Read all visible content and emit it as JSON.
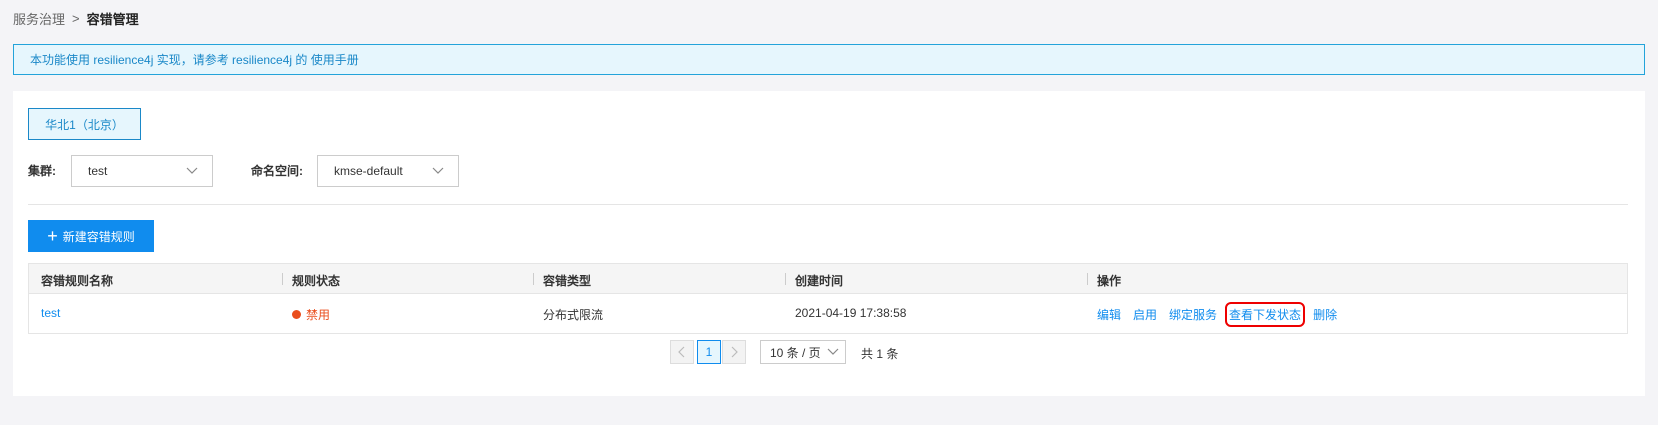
{
  "breadcrumb": {
    "parent": "服务治理",
    "separator": ">",
    "current": "容错管理"
  },
  "notice": {
    "text": "本功能使用 resilience4j 实现，请参考 resilience4j 的 使用手册"
  },
  "region": {
    "label": "华北1（北京）"
  },
  "filters": {
    "cluster_label": "集群:",
    "cluster_value": "test",
    "namespace_label": "命名空间:",
    "namespace_value": "kmse-default"
  },
  "add_button": {
    "label": "新建容错规则"
  },
  "table": {
    "columns": [
      "容错规则名称",
      "规则状态",
      "容错类型",
      "创建时间",
      "操作"
    ],
    "rows": [
      {
        "name": "test",
        "status": "禁用",
        "type": "分布式限流",
        "created": "2021-04-19 17:38:58",
        "actions": [
          "编辑",
          "启用",
          "绑定服务",
          "查看下发状态",
          "删除"
        ]
      }
    ]
  },
  "pagination": {
    "current_page": "1",
    "page_size": "10 条 / 页",
    "total": "共 1 条"
  },
  "colors": {
    "primary": "#108cee",
    "danger": "#ea4e1d",
    "notice_bg": "#e6f6fd"
  }
}
